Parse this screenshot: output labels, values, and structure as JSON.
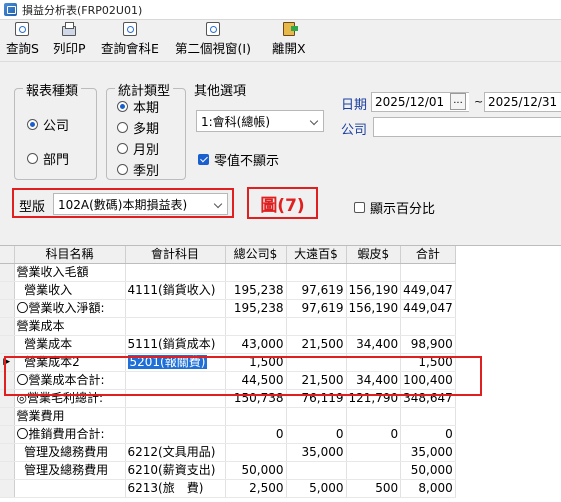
{
  "window": {
    "title": "損益分析表(FRP02U01)"
  },
  "toolbar": [
    {
      "label": "查詢S",
      "icon": "query-icon"
    },
    {
      "label": "列印P",
      "icon": "print-icon"
    },
    {
      "label": "查詢會科E",
      "icon": "query-icon"
    },
    {
      "label": "第二個視窗(I)",
      "icon": "query-icon"
    },
    {
      "label": "離開X",
      "icon": "exit-icon"
    }
  ],
  "report_type": {
    "title": "報表種類",
    "options": [
      "公司",
      "部門"
    ],
    "selected": "公司"
  },
  "period_type": {
    "title": "統計類型",
    "options": [
      "本期",
      "多期",
      "月別",
      "季別"
    ],
    "selected": "本期"
  },
  "other_options": {
    "title": "其他選項",
    "select_value": "1:會科(總帳)",
    "zero_hide_label": "零值不顯示",
    "zero_hide_checked": true
  },
  "date": {
    "label": "日期",
    "from": "2025/12/01",
    "dots": "...",
    "sep": "~",
    "to": "2025/12/31"
  },
  "company": {
    "label": "公司",
    "value": ""
  },
  "template": {
    "label": "型版",
    "value": "102A(數碼)本期損益表)"
  },
  "annotation": "圖(7)",
  "show_percent": {
    "label": "顯示百分比",
    "checked": false
  },
  "grid": {
    "headers": [
      "科目名稱",
      "會計科目",
      "總公司$",
      "大遠百$",
      "蝦皮$",
      "合計"
    ],
    "rows": [
      {
        "name": "營業收入毛額",
        "acct": "",
        "v1": "",
        "v2": "",
        "v3": "",
        "total": ""
      },
      {
        "name": "  營業收入",
        "acct": "4111(銷貨收入)",
        "v1": "195,238",
        "v2": "97,619",
        "v3": "156,190",
        "total": "449,047"
      },
      {
        "name": "〇營業收入淨額:",
        "acct": "",
        "v1": "195,238",
        "v2": "97,619",
        "v3": "156,190",
        "total": "449,047"
      },
      {
        "name": "營業成本",
        "acct": "",
        "v1": "",
        "v2": "",
        "v3": "",
        "total": ""
      },
      {
        "name": "  營業成本",
        "acct": "5111(銷貨成本)",
        "v1": "43,000",
        "v2": "21,500",
        "v3": "34,400",
        "total": "98,900"
      },
      {
        "name": "  營業成本2",
        "acct": "5201(報關費)",
        "v1": "1,500",
        "v2": "",
        "v3": "",
        "total": "1,500",
        "current": true,
        "selected": true
      },
      {
        "name": "〇營業成本合計:",
        "acct": "",
        "v1": "44,500",
        "v2": "21,500",
        "v3": "34,400",
        "total": "100,400"
      },
      {
        "name": "◎營業毛利總計:",
        "acct": "",
        "v1": "150,738",
        "v2": "76,119",
        "v3": "121,790",
        "total": "348,647"
      },
      {
        "name": "營業費用",
        "acct": "",
        "v1": "",
        "v2": "",
        "v3": "",
        "total": ""
      },
      {
        "name": "〇推銷費用合計:",
        "acct": "",
        "v1": "0",
        "v2": "0",
        "v3": "0",
        "total": "0"
      },
      {
        "name": "  管理及總務費用",
        "acct": "6212(文具用品)",
        "v1": "",
        "v2": "35,000",
        "v3": "",
        "total": "35,000"
      },
      {
        "name": "  管理及總務費用",
        "acct": "6210(薪資支出)",
        "v1": "50,000",
        "v2": "",
        "v3": "",
        "total": "50,000"
      },
      {
        "name": "",
        "acct": "6213(旅　費)",
        "v1": "2,500",
        "v2": "5,000",
        "v3": "500",
        "total": "8,000"
      }
    ]
  }
}
